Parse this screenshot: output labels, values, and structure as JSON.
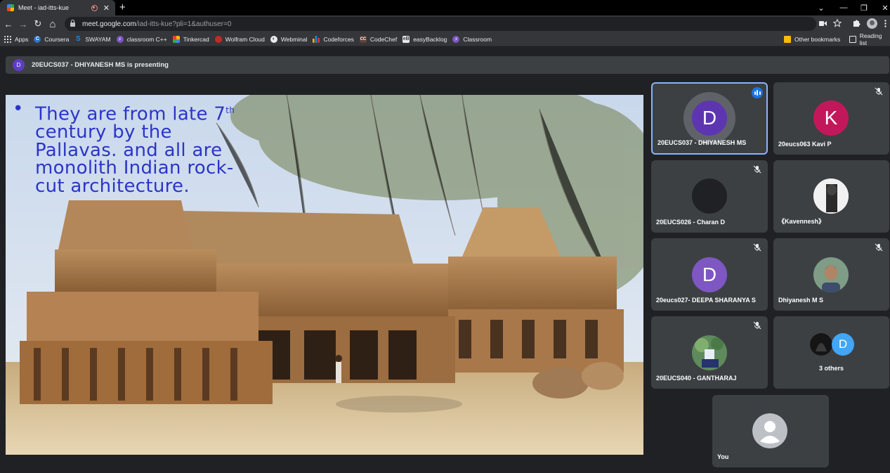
{
  "browser": {
    "tab_title": "Meet - iad-itts-kue",
    "tab_close": "✕",
    "new_tab": "+",
    "url_host": "meet.google.com",
    "url_path": "/iad-itts-kue?pli=1&authuser=0",
    "window": {
      "dropdown": "⌄",
      "minimize": "—",
      "restore": "❐",
      "close": "✕"
    },
    "nav": {
      "back": "←",
      "forward": "→",
      "reload": "↻",
      "home": "⌂"
    }
  },
  "bookmarks": {
    "items": [
      {
        "label": "Apps",
        "icon": "apps-grid-icon",
        "color": "#e8eaed"
      },
      {
        "label": "Coursera",
        "icon": "coursera-icon",
        "color": "#2a73cc"
      },
      {
        "label": "SWAYAM",
        "icon": "swayam-icon",
        "color": "#1e88e5"
      },
      {
        "label": "classroom C++",
        "icon": "bolt-icon",
        "color": "#7e57c2"
      },
      {
        "label": "Tinkercad",
        "icon": "tinkercad-icon",
        "color": "#fbbc04"
      },
      {
        "label": "Wolfram Cloud",
        "icon": "wolfram-icon",
        "color": "#d32f2f"
      },
      {
        "label": "Webminal",
        "icon": "webminal-icon",
        "color": "#e8eaed"
      },
      {
        "label": "Codeforces",
        "icon": "codeforces-icon",
        "color": "#fbbc04"
      },
      {
        "label": "CodeChef",
        "icon": "codechef-icon",
        "color": "#6d4c41"
      },
      {
        "label": "easyBacklog",
        "icon": "easybacklog-icon",
        "color": "#e8eaed"
      },
      {
        "label": "Classroom",
        "icon": "bolt-icon",
        "color": "#7e57c2"
      }
    ],
    "other": "Other bookmarks",
    "reading_list": "Reading list"
  },
  "meet": {
    "presenting_avatar": "D",
    "presenting_text": "20EUCS037 - DHIYANESH MS is presenting",
    "slide_lines": [
      "They are from late 7",
      "century by the",
      "Pallavas. and all are",
      "monolith Indian rock-",
      "cut architecture."
    ],
    "slide_superscript": "th",
    "slide_bullet": "•",
    "participants": [
      {
        "name": "20EUCS037 - DHIYANESH MS",
        "initial": "D",
        "color": "#5e35b1",
        "state": "speaking"
      },
      {
        "name": "20eucs063 Kavi P",
        "initial": "K",
        "color": "#c2185b",
        "state": "muted"
      },
      {
        "name": "20EUCS026 - Charan D",
        "initial": "",
        "color": "#202124",
        "state": "muted"
      },
      {
        "name": "《Kavennesh》",
        "initial": "",
        "color": "#e0e0e0",
        "state": "none"
      },
      {
        "name": "20eucs027- DEEPA SHARANYA S",
        "initial": "D",
        "color": "#7e57c2",
        "state": "muted"
      },
      {
        "name": "Dhiyanesh M S",
        "initial": "",
        "color": "#6d8b74",
        "state": "muted"
      },
      {
        "name": "20EUCS040 - GANTHARAJ",
        "initial": "",
        "color": "#4e7d5b",
        "state": "muted"
      },
      {
        "name": "",
        "initial": "D",
        "color": "#42a5f5",
        "state": "none"
      },
      {
        "name": "You",
        "initial": "",
        "color": "#bdc1c6",
        "state": "none"
      }
    ],
    "others_label": "3 others"
  }
}
